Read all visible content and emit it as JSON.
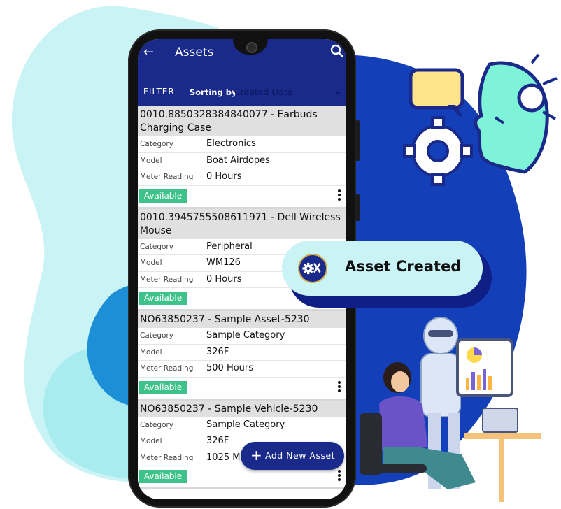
{
  "colors": {
    "app_bar": "#1a2a8a",
    "available_badge": "#3dc28a",
    "card_header": "#e0e0e0",
    "blob_light": "#c9f3f5",
    "blob_dark": "#1340b8",
    "toast_bg": "#c9f3f5",
    "toast_shadow": "#0f1f86"
  },
  "header": {
    "back_icon": "arrow-left-icon",
    "title": "Assets",
    "search_icon": "search-icon"
  },
  "filter_bar": {
    "filter_label": "FILTER",
    "sorting_label": "Sorting by",
    "sorting_value": "Created Date"
  },
  "assets": [
    {
      "title": "0010.8850328384840077 - Earbuds Charging Case",
      "category_label": "Category",
      "category": "Electronics",
      "model_label": "Model",
      "model": "Boat Airdopes",
      "meter_label": "Meter Reading",
      "meter": "0 Hours",
      "status": "Available"
    },
    {
      "title": "0010.3945755508611971 - Dell Wireless Mouse",
      "category_label": "Category",
      "category": "Peripheral",
      "model_label": "Model",
      "model": "WM126",
      "meter_label": "Meter Reading",
      "meter": "0 Hours",
      "status": "Available"
    },
    {
      "title": "NO63850237 - Sample Asset-5230",
      "category_label": "Category",
      "category": "Sample Category",
      "model_label": "Model",
      "model": "326F",
      "meter_label": "Meter Reading",
      "meter": "500 Hours",
      "status": "Available"
    },
    {
      "title": "NO63850237 - Sample Vehicle-5230",
      "category_label": "Category",
      "category": "Sample Category",
      "model_label": "Model",
      "model": "326F",
      "meter_label": "Meter Reading",
      "meter": "1025 Mil",
      "status": "Available"
    }
  ],
  "fab": {
    "icon": "plus-icon",
    "label": "Add New Asset"
  },
  "toast": {
    "icon": "gear-wrench-icon",
    "text": "Asset Created"
  }
}
